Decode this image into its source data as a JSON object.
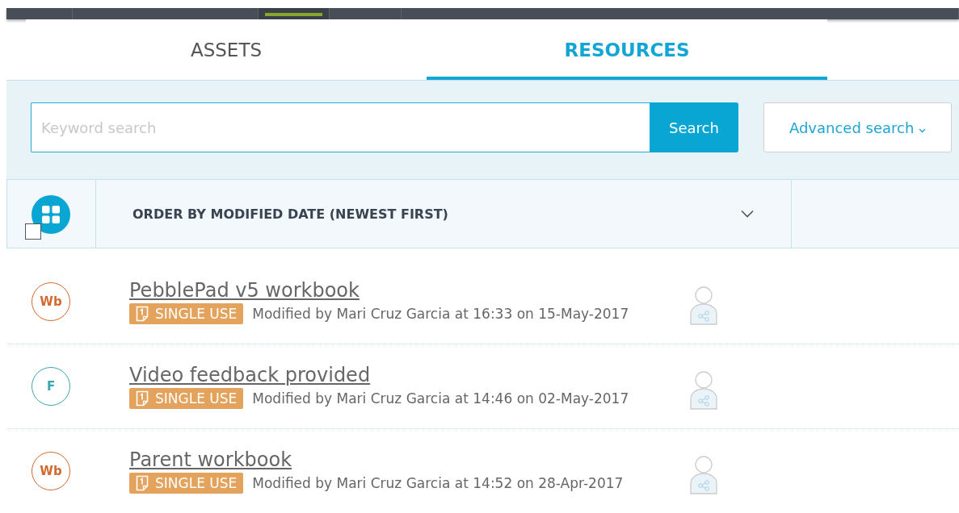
{
  "top_bar": [
    {
      "selected": false
    },
    {
      "selected": false
    },
    {
      "selected": true
    },
    {
      "selected": false
    },
    {
      "selected": false
    }
  ],
  "tabs": [
    {
      "label": "ASSETS",
      "selected": false
    },
    {
      "label": "RESOURCES",
      "selected": true
    }
  ],
  "search": {
    "placeholder": "Keyword search",
    "button": "Search",
    "advanced": "Advanced search"
  },
  "toolbar": {
    "select_all": {
      "checked": false
    },
    "order_by": "ORDER BY MODIFIED DATE (NEWEST FIRST)"
  },
  "items": [
    {
      "type": "Wb",
      "color": "#d2692f",
      "title": "PebblePad v5 workbook",
      "badge": "SINGLE USE",
      "modified": "Modified by Mari Cruz Garcia at 16:33 on 15-May-2017"
    },
    {
      "type": "F",
      "color": "#3aa7b0",
      "title": "Video feedback provided",
      "badge": "SINGLE USE",
      "modified": "Modified by Mari Cruz Garcia at 14:46 on 02-May-2017"
    },
    {
      "type": "Wb",
      "color": "#d2692f",
      "title": "Parent workbook",
      "badge": "SINGLE USE",
      "modified": "Modified by Mari Cruz Garcia at 14:52 on 28-Apr-2017"
    }
  ]
}
